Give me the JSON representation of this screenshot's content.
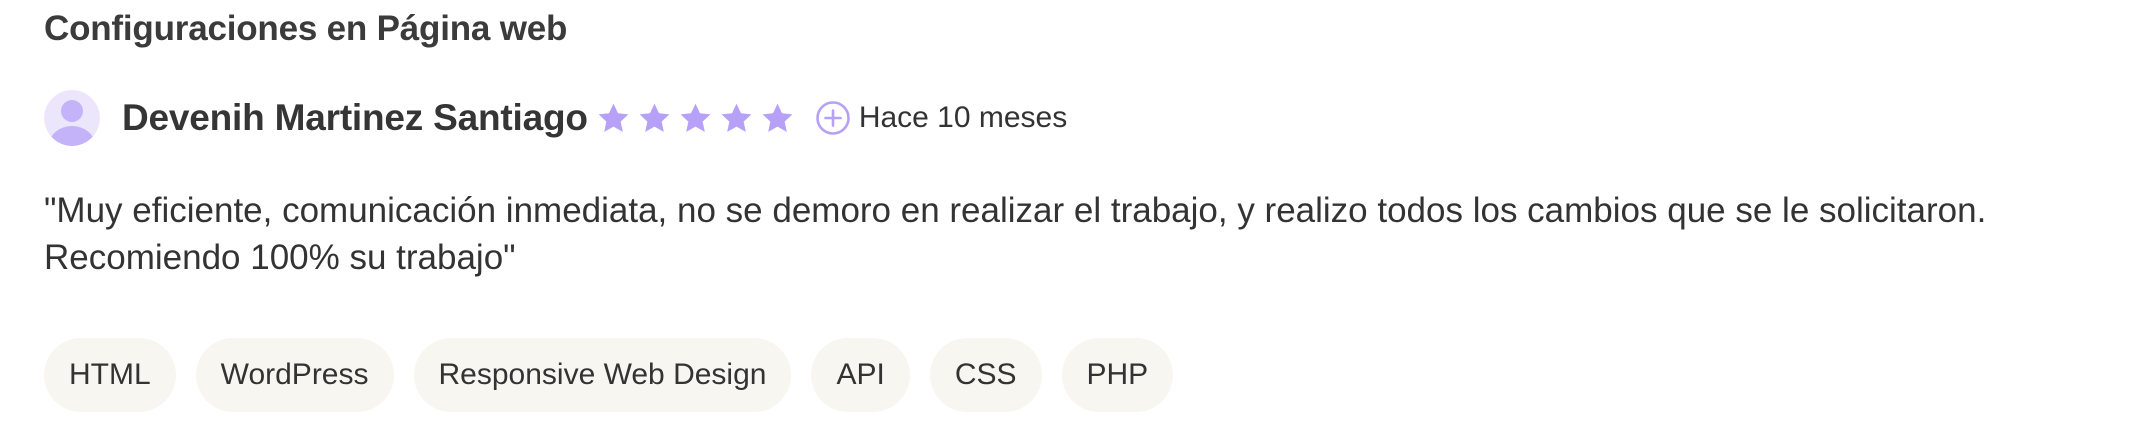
{
  "review": {
    "project_title": "Configuraciones en Página web",
    "reviewer_name": "Devenih Martinez Santiago",
    "rating": 5,
    "rating_max": 5,
    "time_ago": "Hace 10 meses",
    "comment": "\"Muy eficiente, comunicación inmediata, no se demoro en realizar el trabajo, y realizo todos los cambios que se le solicitaron. Recomiendo 100% su trabajo\"",
    "skills": [
      "HTML",
      "WordPress",
      "Responsive Web Design",
      "API",
      "CSS",
      "PHP"
    ]
  },
  "icons": {
    "avatar": "user-avatar-icon",
    "star": "star-icon",
    "verified": "plus-circle-icon"
  },
  "colors": {
    "star": "#b7a1f8",
    "avatar_bg": "#ece6fd",
    "avatar_figure": "#c4b3f9",
    "tag_bg": "#f7f6f1",
    "text": "#333333"
  }
}
